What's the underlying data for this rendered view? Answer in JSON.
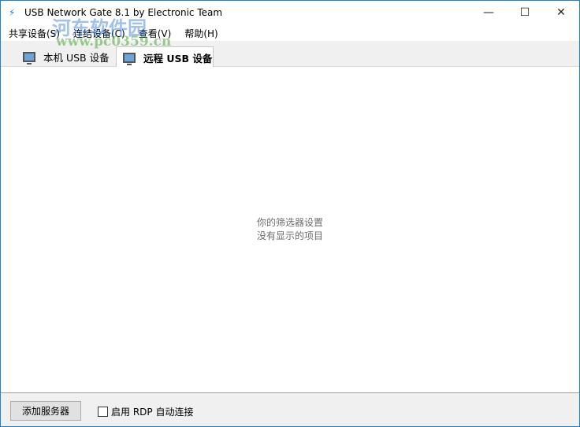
{
  "window": {
    "title": "USB Network Gate 8.1 by Electronic Team"
  },
  "menu": [
    {
      "label": "共享设备(S)"
    },
    {
      "label": "连结设备(C)"
    },
    {
      "label": "查看(V)"
    },
    {
      "label": "帮助(H)"
    }
  ],
  "tabs": [
    {
      "label": "本机 USB 设备",
      "active": false
    },
    {
      "label": "远程 USB 设备",
      "active": true
    }
  ],
  "content": {
    "empty_line1": "你的筛选器设置",
    "empty_line2": "没有显示的项目"
  },
  "bottom": {
    "add_server": "添加服务器",
    "rdp_checkbox": "启用 RDP 自动连接",
    "rdp_checked": false
  },
  "watermark": {
    "line1": "河东软件园",
    "line2": "www.pc0359.cn"
  }
}
